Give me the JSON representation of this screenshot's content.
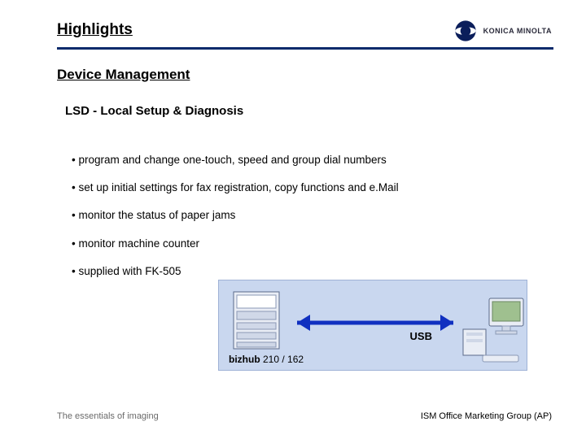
{
  "title": "Highlights",
  "brand": {
    "name": "KONICA MINOLTA"
  },
  "subtitle": "Device Management",
  "section_heading": "LSD - Local Setup & Diagnosis",
  "bullets": [
    "program and change one-touch, speed and group dial numbers",
    "set up initial settings for fax registration, copy functions and e.Mail",
    "monitor the status of paper jams",
    "monitor machine counter",
    "supplied with FK-505"
  ],
  "diagram": {
    "connection_label": "USB",
    "device_label_html": "bizhub",
    "device_models": " 210 / 162"
  },
  "tagline": "The essentials of imaging",
  "footer": "ISM Office Marketing Group (AP)"
}
